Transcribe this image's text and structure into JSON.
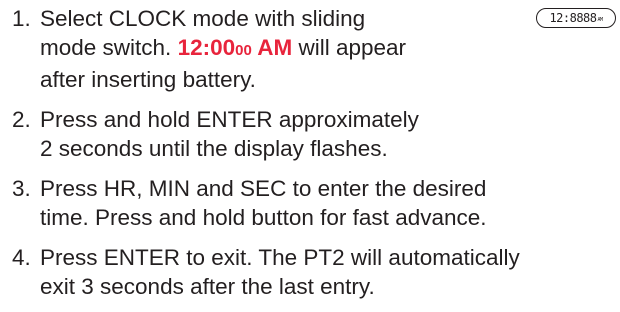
{
  "display": {
    "digits": "12:8888",
    "suffix": "AM"
  },
  "steps": [
    {
      "number": "1.",
      "line1": "Select CLOCK mode with sliding",
      "line2_pre": "mode switch. ",
      "time_main": "12:00",
      "time_sec": "00",
      "time_ampm": " AM",
      "line2_post": " will appear",
      "line3": "after inserting battery."
    },
    {
      "number": "2.",
      "line1": "Press and hold ENTER approximately",
      "line2": "2 seconds until the display flashes."
    },
    {
      "number": "3.",
      "line1": "Press HR, MIN and SEC to enter the desired",
      "line2": "time. Press and hold button for fast advance."
    },
    {
      "number": "4.",
      "line1": "Press ENTER to exit. The PT2 will automatically",
      "line2": "exit 3 seconds after the last entry."
    }
  ]
}
